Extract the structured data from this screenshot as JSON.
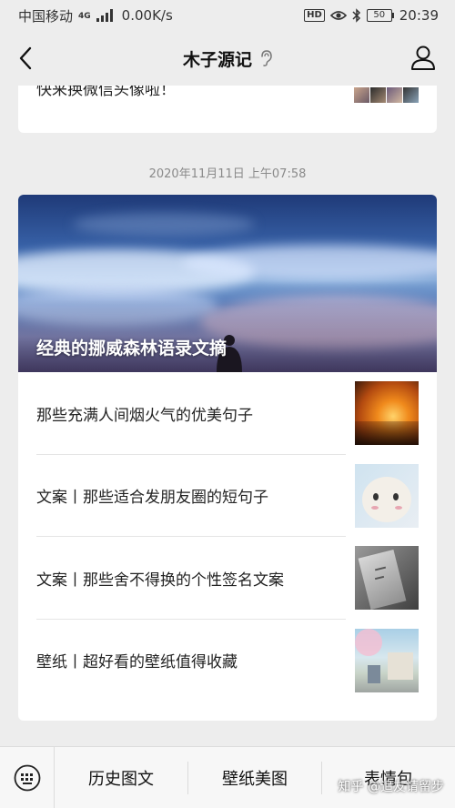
{
  "status_bar": {
    "carrier": "中国移动",
    "network": "4G",
    "speed": "0.00K/s",
    "hd": "HD",
    "battery": "50",
    "time": "20:39"
  },
  "nav": {
    "title": "木子源记",
    "back_icon": "chevron-left-icon",
    "ear_icon": "ear-icon",
    "profile_icon": "person-icon"
  },
  "previous_card": {
    "text": "快来换微信头像啦！"
  },
  "timestamp": "2020年11月11日 上午07:58",
  "article": {
    "cover_title": "经典的挪威森林语录文摘",
    "items": [
      {
        "title": "那些充满人间烟火气的优美句子",
        "thumb": "sunset-thumb"
      },
      {
        "title": "文案丨那些适合发朋友圈的短句子",
        "thumb": "cat-thumb"
      },
      {
        "title": "文案丨那些舍不得换的个性签名文案",
        "thumb": "book-thumb"
      },
      {
        "title": "壁纸丨超好看的壁纸值得收藏",
        "thumb": "anime-thumb"
      }
    ]
  },
  "bottom_menu": {
    "keyboard_icon": "keyboard-icon",
    "items": [
      "历史图文",
      "壁纸美图",
      "表情包"
    ]
  },
  "watermark": "知乎 @追友请留步"
}
